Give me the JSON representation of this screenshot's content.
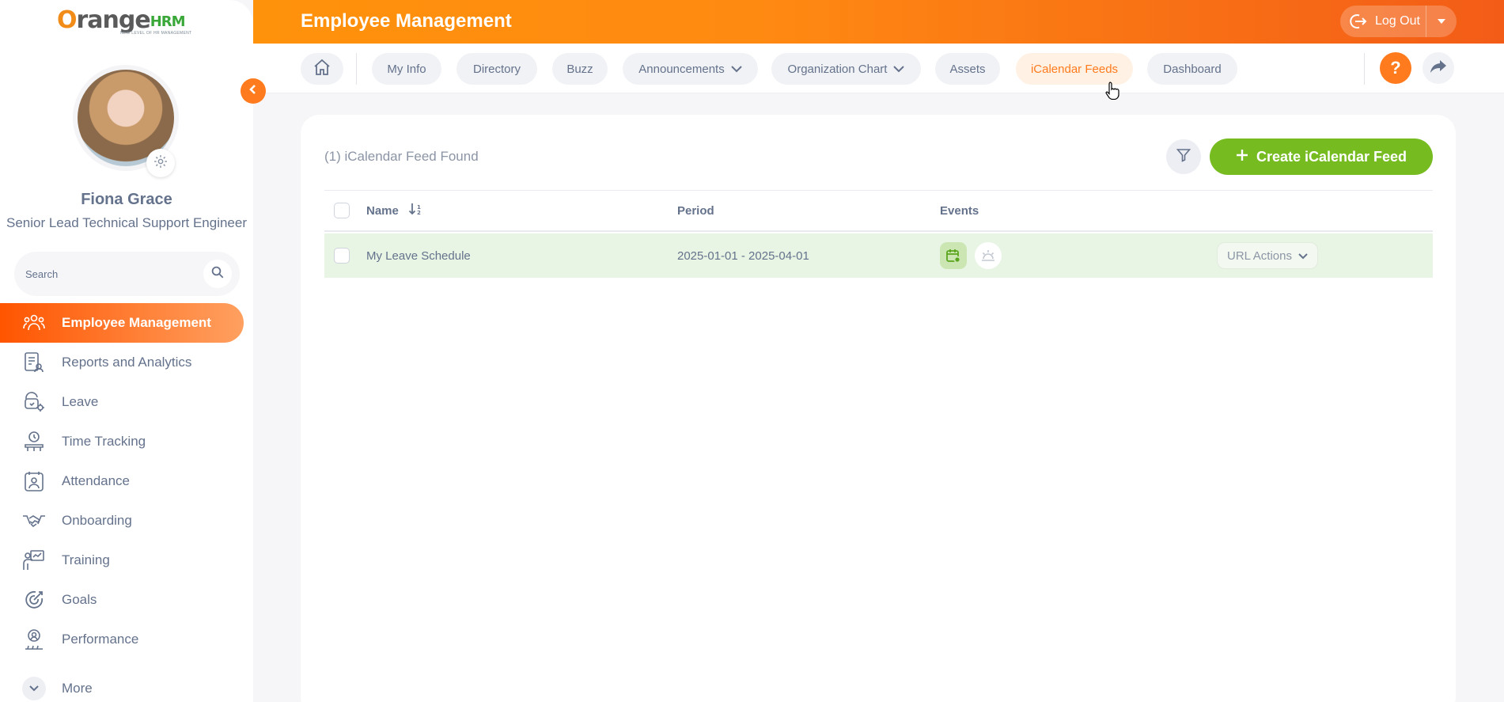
{
  "app": {
    "logo_main": "range",
    "logo_o": "O",
    "logo_hrm": "HRM",
    "logo_tagline": "NEW LEVEL OF HR MANAGEMENT"
  },
  "header": {
    "title": "Employee Management",
    "logout_label": "Log Out"
  },
  "user": {
    "name": "Fiona Grace",
    "title": "Senior Lead Technical Support Engineer"
  },
  "sidebar": {
    "search_placeholder": "Search",
    "items": [
      {
        "label": "Employee Management",
        "icon": "people-icon",
        "active": true
      },
      {
        "label": "Reports and Analytics",
        "icon": "report-icon",
        "active": false
      },
      {
        "label": "Leave",
        "icon": "leave-icon",
        "active": false
      },
      {
        "label": "Time Tracking",
        "icon": "time-tracking-icon",
        "active": false
      },
      {
        "label": "Attendance",
        "icon": "attendance-icon",
        "active": false
      },
      {
        "label": "Onboarding",
        "icon": "handshake-icon",
        "active": false
      },
      {
        "label": "Training",
        "icon": "training-icon",
        "active": false
      },
      {
        "label": "Goals",
        "icon": "goals-icon",
        "active": false
      },
      {
        "label": "Performance",
        "icon": "performance-icon",
        "active": false
      }
    ],
    "more_label": "More"
  },
  "nav": {
    "tabs": [
      {
        "label": "My Info"
      },
      {
        "label": "Directory"
      },
      {
        "label": "Buzz"
      },
      {
        "label": "Announcements"
      },
      {
        "label": "Organization Chart"
      },
      {
        "label": "Assets"
      },
      {
        "label": "iCalendar Feeds"
      },
      {
        "label": "Dashboard"
      }
    ],
    "help_label": "?"
  },
  "main": {
    "record_count": "(1) iCalendar Feed Found",
    "create_label": "Create iCalendar Feed",
    "columns": {
      "name": "Name",
      "period": "Period",
      "events": "Events"
    },
    "rows": [
      {
        "name": "My Leave Schedule",
        "period": "2025-01-01 - 2025-04-01",
        "actions_label": "URL Actions"
      }
    ]
  },
  "colors": {
    "accent": "#ff7b1d",
    "create": "#76bc21",
    "row_highlight": "#e8f4e4",
    "text": "#64728c"
  }
}
